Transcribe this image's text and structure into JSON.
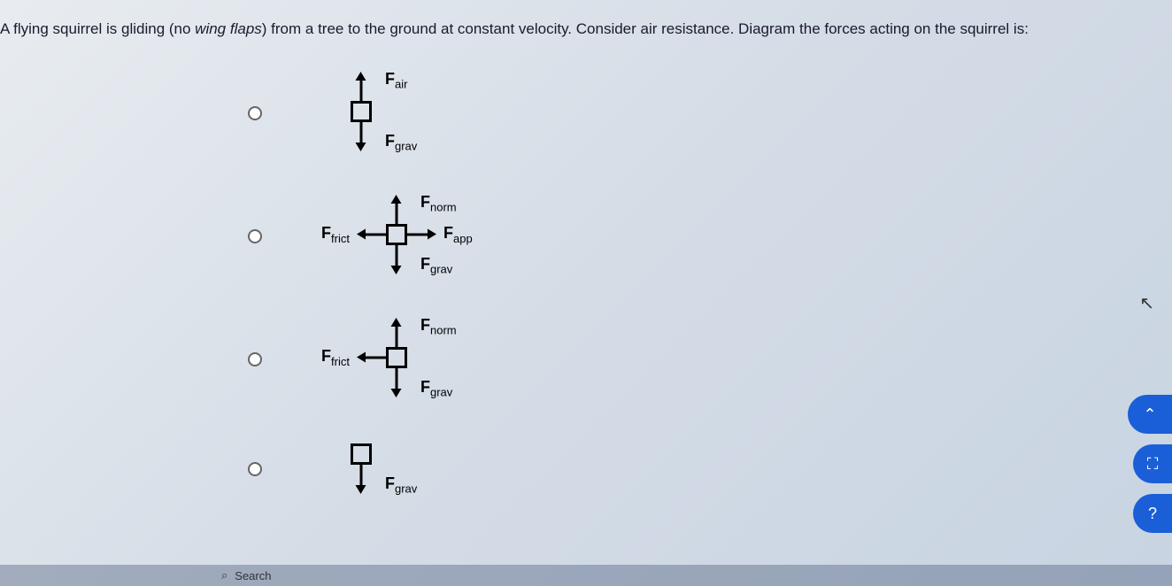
{
  "question": {
    "text_before_italic": "A flying squirrel is gliding (no ",
    "italic_text": "wing flaps",
    "text_after_italic": ") from a tree to the ground at constant velocity. Consider air resistance. Diagram the forces acting on the squirrel is:"
  },
  "labels": {
    "F_air": "F",
    "F_air_sub": "air",
    "F_grav": "F",
    "F_grav_sub": "grav",
    "F_norm": "F",
    "F_norm_sub": "norm",
    "F_frict": "F",
    "F_frict_sub": "frict",
    "F_app": "F",
    "F_app_sub": "app"
  },
  "taskbar": {
    "search_placeholder": "Search"
  },
  "icons": {
    "cursor": "⬀",
    "search": "⌕",
    "chevron_up": "⌃",
    "expand": "⛶",
    "help": "?"
  }
}
